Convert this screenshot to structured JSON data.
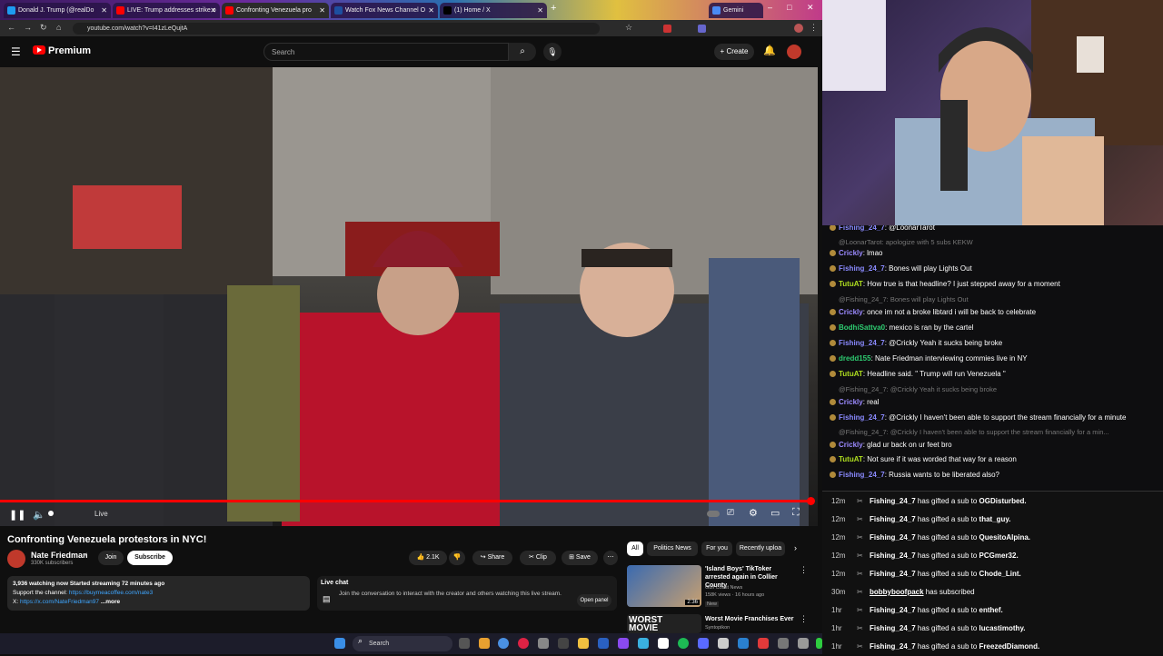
{
  "browser": {
    "tabs": [
      {
        "label": "Donald J. Trump (@realDo",
        "color": "#1d9bf0"
      },
      {
        "label": "LIVE: Trump addresses strike o",
        "color": "#ff0000"
      },
      {
        "label": "Confronting Venezuela pro",
        "color": "#ff0000"
      },
      {
        "label": "Watch Fox News Channel O",
        "color": "#1d4fa0"
      },
      {
        "label": "(1) Home / X",
        "color": "#000000"
      },
      {
        "label": "Gemini",
        "color": "#4a8af4"
      }
    ],
    "url": "youtube.com/watch?v=I41zLeQujtA"
  },
  "yt": {
    "logo": "Premium",
    "search_placeholder": "Search",
    "create_label": "+ Create"
  },
  "player": {
    "live_label": "Live"
  },
  "video": {
    "title": "Confronting Venezuela protestors in NYC!",
    "channel": "Nate Friedman",
    "subscribers": "330K subscribers",
    "join_label": "Join",
    "subscribe_label": "Subscribe",
    "likes": "2.1K",
    "share_label": "Share",
    "clip_label": "Clip",
    "save_label": "Save",
    "desc_line1": "3,936 watching now  Started streaming 72 minutes ago",
    "desc_line2_prefix": "Support the channel: ",
    "desc_line2_link": "https://buymeacoffee.com/nate3",
    "desc_line3_prefix": "X: ",
    "desc_line3_link": "https://x.com/NateFriedman97",
    "desc_more": " ...more"
  },
  "livechat": {
    "title": "Live chat",
    "body": "Join the conversation to interact with the creator and others watching this live stream.",
    "open_panel": "Open panel"
  },
  "chips": [
    "All",
    "Politics News",
    "For you",
    "Recently uploa"
  ],
  "recs": [
    {
      "title": "'Island Boys' TikToker arrested again in Collier County",
      "channel": "Gulf Coast News",
      "meta": "158K views · 16 hours ago",
      "badge": "New",
      "duration": "2:36"
    },
    {
      "title": "Worst Movie Franchises Ever",
      "channel": "Syntopikon",
      "thumb_text": "WORST MOVIE"
    }
  ],
  "chat": [
    {
      "user": "Fishing_24_7",
      "text": "@LoonarTarot",
      "color": "#8a8aff",
      "reply": false
    },
    {
      "user": "",
      "text": "@LoonarTarot: apologize with 5 subs KEKW",
      "color": "#777777",
      "reply": true
    },
    {
      "user": "Crickly",
      "text": "lmao",
      "color": "#9b8aff",
      "reply": false
    },
    {
      "user": "Fishing_24_7",
      "text": "Bones will play Lights Out",
      "color": "#8a8aff",
      "reply": false
    },
    {
      "user": "TutuAT",
      "text": "How true is that headline? I just stepped away for a moment",
      "color": "#b0e020",
      "reply": false
    },
    {
      "user": "",
      "text": "@Fishing_24_7: Bones will play Lights Out",
      "color": "#777777",
      "reply": true
    },
    {
      "user": "Crickly",
      "text": "once im not a broke libtard i will be back to celebrate",
      "color": "#9b8aff",
      "reply": false
    },
    {
      "user": "BodhiSattva0",
      "text": "mexico is ran by the cartel",
      "color": "#2ecc71",
      "reply": false
    },
    {
      "user": "Fishing_24_7",
      "text": "@Crickly Yeah it sucks being broke",
      "color": "#8a8aff",
      "reply": false
    },
    {
      "user": "dredd155",
      "text": "Nate Friedman interviewing commies live in NY",
      "color": "#2ecc71",
      "reply": false
    },
    {
      "user": "TutuAT",
      "text": "Headline said. \" Trump will run Venezuela \"",
      "color": "#b0e020",
      "reply": false
    },
    {
      "user": "",
      "text": "@Fishing_24_7: @Crickly Yeah it sucks being broke",
      "color": "#777777",
      "reply": true
    },
    {
      "user": "Crickly",
      "text": "real",
      "color": "#9b8aff",
      "reply": false
    },
    {
      "user": "Fishing_24_7",
      "text": "@Crickly I haven't been able to support the stream financially for a minute",
      "color": "#8a8aff",
      "reply": false
    },
    {
      "user": "",
      "text": "@Fishing_24_7: @Crickly I haven't been able to support the stream financially for a min...",
      "color": "#777777",
      "reply": true
    },
    {
      "user": "Crickly",
      "text": "glad ur back on ur feet bro",
      "color": "#9b8aff",
      "reply": false
    },
    {
      "user": "TutuAT",
      "text": "Not sure if it was worded that way for a reason",
      "color": "#b0e020",
      "reply": false
    },
    {
      "user": "Fishing_24_7",
      "text": "Russia wants to be liberated also?",
      "color": "#8a8aff",
      "reply": false
    }
  ],
  "events": [
    {
      "time": "12m",
      "user": "Fishing_24_7",
      "action": "has gifted a sub to",
      "target": "OGDisturbed."
    },
    {
      "time": "12m",
      "user": "Fishing_24_7",
      "action": "has gifted a sub to",
      "target": "that_guy."
    },
    {
      "time": "12m",
      "user": "Fishing_24_7",
      "action": "has gifted a sub to",
      "target": "QuesitoAlpina."
    },
    {
      "time": "12m",
      "user": "Fishing_24_7",
      "action": "has gifted a sub to",
      "target": "PCGmer32."
    },
    {
      "time": "12m",
      "user": "Fishing_24_7",
      "action": "has gifted a sub to",
      "target": "Chode_Lint."
    },
    {
      "time": "30m",
      "user": "bobbyboofpack",
      "action": "has subscribed",
      "target": ""
    },
    {
      "time": "1hr",
      "user": "Fishing_24_7",
      "action": "has gifted a sub to",
      "target": "enthef."
    },
    {
      "time": "1hr",
      "user": "Fishing_24_7",
      "action": "has gifted a sub to",
      "target": "lucastimothy."
    },
    {
      "time": "1hr",
      "user": "Fishing_24_7",
      "action": "has gifted a sub to",
      "target": "FreezedDiamond."
    }
  ],
  "taskbar": {
    "search": "Search"
  }
}
